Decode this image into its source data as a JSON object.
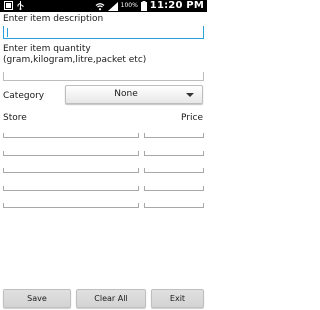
{
  "status_bar": {
    "battery_percent": "100%",
    "time": "11:20 PM",
    "icons": [
      "notification-icon",
      "usb-icon",
      "wifi-icon",
      "signal-icon",
      "battery-icon"
    ]
  },
  "form": {
    "description_label": "Enter item description",
    "description_value": "",
    "quantity_label": "Enter item quantity (gram,kilogram,litre,packet etc)",
    "quantity_value": "",
    "category_label": "Category",
    "category_selected": "None",
    "store_header": "Store",
    "price_header": "Price",
    "store_rows": [
      "",
      "",
      "",
      "",
      ""
    ],
    "price_rows": [
      "",
      "",
      "",
      "",
      ""
    ]
  },
  "buttons": {
    "save": "Save",
    "clear_all": "Clear All",
    "exit": "Exit"
  },
  "colors": {
    "accent": "#2aa1d6",
    "status_bar": "#000000"
  }
}
